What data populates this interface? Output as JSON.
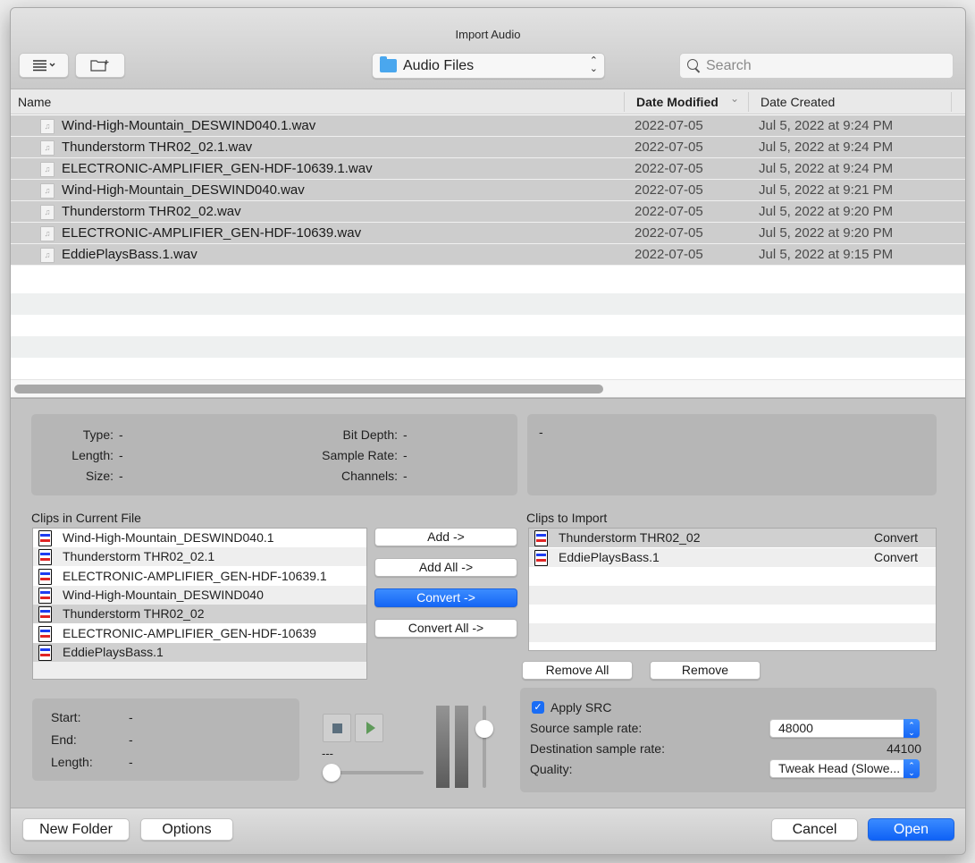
{
  "window": {
    "title": "Import Audio"
  },
  "toolbar": {
    "view_menu_icon": "list-view-icon",
    "new_folder_icon": "new-folder-icon",
    "location": "Audio Files",
    "search_placeholder": "Search"
  },
  "file_browser": {
    "columns": {
      "name": "Name",
      "date_modified": "Date Modified",
      "date_created": "Date Created"
    },
    "sort_indicator": "⌄",
    "files": [
      {
        "name": "Wind-High-Mountain_DESWIND040.1.wav",
        "modified": "2022-07-05",
        "created": "Jul 5, 2022 at 9:24 PM"
      },
      {
        "name": "Thunderstorm THR02_02.1.wav",
        "modified": "2022-07-05",
        "created": "Jul 5, 2022 at 9:24 PM"
      },
      {
        "name": "ELECTRONIC-AMPLIFIER_GEN-HDF-10639.1.wav",
        "modified": "2022-07-05",
        "created": "Jul 5, 2022 at 9:24 PM"
      },
      {
        "name": "Wind-High-Mountain_DESWIND040.wav",
        "modified": "2022-07-05",
        "created": "Jul 5, 2022 at 9:21 PM"
      },
      {
        "name": "Thunderstorm THR02_02.wav",
        "modified": "2022-07-05",
        "created": "Jul 5, 2022 at 9:20 PM"
      },
      {
        "name": "ELECTRONIC-AMPLIFIER_GEN-HDF-10639.wav",
        "modified": "2022-07-05",
        "created": "Jul 5, 2022 at 9:20 PM"
      },
      {
        "name": "EddiePlaysBass.1.wav",
        "modified": "2022-07-05",
        "created": "Jul 5, 2022 at 9:15 PM"
      }
    ]
  },
  "file_info": {
    "type_label": "Type:",
    "type_value": "-",
    "length_label": "Length:",
    "length_value": "-",
    "size_label": "Size:",
    "size_value": "-",
    "bit_depth_label": "Bit Depth:",
    "bit_depth_value": "-",
    "sample_rate_label": "Sample Rate:",
    "sample_rate_value": "-",
    "channels_label": "Channels:",
    "channels_value": "-",
    "description": "-"
  },
  "clips_current": {
    "label": "Clips in Current File",
    "items": [
      {
        "name": "Wind-High-Mountain_DESWIND040.1"
      },
      {
        "name": "Thunderstorm THR02_02.1"
      },
      {
        "name": "ELECTRONIC-AMPLIFIER_GEN-HDF-10639.1"
      },
      {
        "name": "Wind-High-Mountain_DESWIND040"
      },
      {
        "name": "Thunderstorm THR02_02"
      },
      {
        "name": "ELECTRONIC-AMPLIFIER_GEN-HDF-10639"
      },
      {
        "name": "EddiePlaysBass.1"
      }
    ]
  },
  "transfer_buttons": {
    "add": "Add ->",
    "add_all": "Add All ->",
    "convert": "Convert ->",
    "convert_all": "Convert All ->"
  },
  "clips_import": {
    "label": "Clips to Import",
    "items": [
      {
        "name": "Thunderstorm THR02_02",
        "action": "Convert"
      },
      {
        "name": "EddiePlaysBass.1",
        "action": "Convert"
      }
    ],
    "remove_all": "Remove All",
    "remove": "Remove"
  },
  "clip_info": {
    "start_label": "Start:",
    "start_value": "-",
    "end_label": "End:",
    "end_value": "-",
    "length_label": "Length:",
    "length_value": "-"
  },
  "playback": {
    "position_text": "---",
    "position_fraction": 0.0,
    "volume_fraction": 0.72
  },
  "src": {
    "apply_label": "Apply SRC",
    "apply_checked": true,
    "source_label": "Source sample rate:",
    "source_value": "48000",
    "dest_label": "Destination sample rate:",
    "dest_value": "44100",
    "quality_label": "Quality:",
    "quality_value": "Tweak Head (Slowe..."
  },
  "footer": {
    "new_folder": "New Folder",
    "options": "Options",
    "cancel": "Cancel",
    "open": "Open"
  },
  "colors": {
    "accent": "#1566f5",
    "selected_row": "#cdcdcd"
  }
}
